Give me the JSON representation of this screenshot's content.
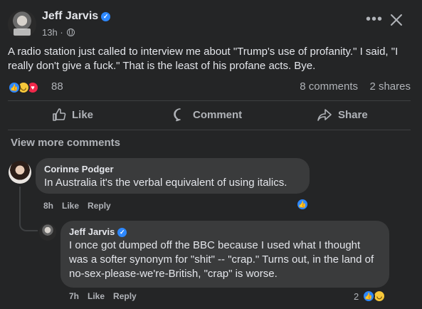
{
  "post": {
    "author": "Jeff Jarvis",
    "time": "13h",
    "separator": "·",
    "text": "A radio station just called to interview me about \"Trump's use of profanity.\" I said, \"I really don't give a fuck.\" That is the least of his profane acts. Bye.",
    "reaction_count": "88",
    "comments_count": "8 comments",
    "shares_count": "2 shares",
    "reaction_icons": [
      "like-icon",
      "haha-icon",
      "love-icon"
    ]
  },
  "actions": {
    "like_label": "Like",
    "comment_label": "Comment",
    "share_label": "Share"
  },
  "view_more_label": "View more comments",
  "comments": [
    {
      "author": "Corinne Podger",
      "text": "In Australia it's the verbal equivalent of using italics.",
      "time": "8h",
      "like_label": "Like",
      "reply_label": "Reply"
    },
    {
      "author": "Jeff Jarvis",
      "text": "I once got dumped off the BBC because I used what I thought was a softer synonym for \"shit\" -- \"crap.\" Turns out, in the land of no-sex-please-we're-British, \"crap\" is worse.",
      "time": "7h",
      "like_label": "Like",
      "reply_label": "Reply",
      "reaction_count": "2"
    }
  ],
  "colors": {
    "background": "#242526",
    "bubble": "#3a3b3c",
    "accent": "#2d88ff",
    "secondary_text": "#b0b3b8"
  }
}
